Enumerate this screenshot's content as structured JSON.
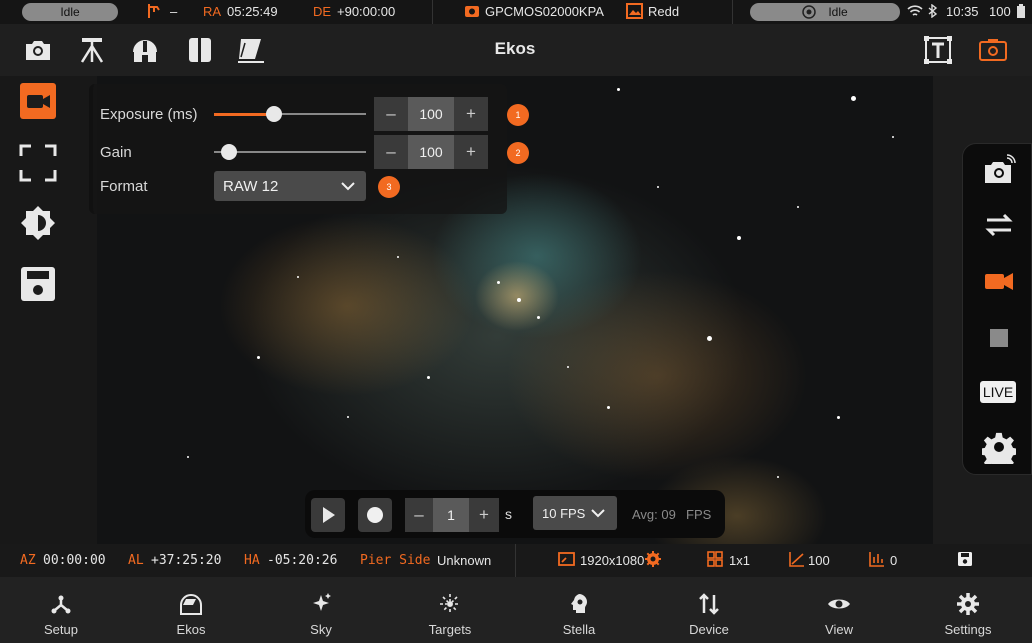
{
  "status": {
    "left_state": "Idle",
    "mount_dash": "–",
    "ra_label": "RA",
    "ra_value": "05:25:49",
    "de_label": "DE",
    "de_value": "+90:00:00",
    "camera_name": "GPCMOS02000KPA",
    "gallery_label": "Redd",
    "right_state": "Idle",
    "clock": "10:35",
    "battery": "100"
  },
  "topbar": {
    "title": "Ekos"
  },
  "settings": {
    "exposure": {
      "label": "Exposure (ms)",
      "value": "100",
      "badge": "1",
      "level": 0.38
    },
    "gain": {
      "label": "Gain",
      "value": "100",
      "badge": "2",
      "level": 0.05
    },
    "format": {
      "label": "Format",
      "value": "RAW 12",
      "badge": "3"
    },
    "minus": "–",
    "plus": "+"
  },
  "capture": {
    "count": "1",
    "unit": "s",
    "fps_option": "10 FPS",
    "avg_label": "Avg: 09",
    "fps_unit": "FPS",
    "minus": "–",
    "plus": "+"
  },
  "right_panel": {
    "live_label": "LIVE"
  },
  "info": {
    "az_label": "AZ",
    "az_value": "00:00:00",
    "al_label": "AL",
    "al_value": "+37:25:20",
    "ha_label": "HA",
    "ha_value": "-05:20:26",
    "pier_label": "Pier Side",
    "pier_value": "Unknown",
    "resolution": "1920x1080",
    "binning": "1x1",
    "gain_value": "100",
    "offset_value": "0"
  },
  "nav": [
    {
      "label": "Setup",
      "icon": "setup-icon"
    },
    {
      "label": "Ekos",
      "icon": "ekos-icon"
    },
    {
      "label": "Sky",
      "icon": "sky-icon"
    },
    {
      "label": "Targets",
      "icon": "targets-icon"
    },
    {
      "label": "Stella",
      "icon": "stella-icon"
    },
    {
      "label": "Device",
      "icon": "device-icon"
    },
    {
      "label": "View",
      "icon": "view-icon"
    },
    {
      "label": "Settings",
      "icon": "settings-icon"
    }
  ],
  "colors": {
    "accent": "#f26a21",
    "background": "#1c1c1c"
  }
}
